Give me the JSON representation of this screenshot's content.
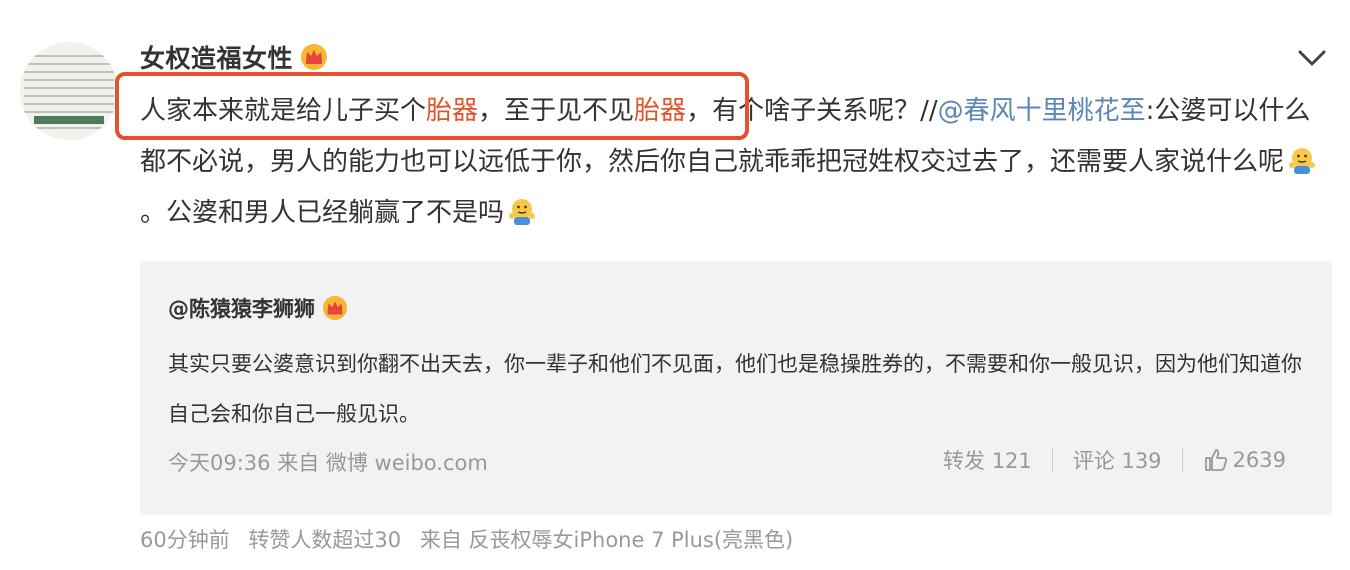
{
  "post": {
    "username": "女权造福女性",
    "text_p1": "人家本来就是给儿子买个",
    "highlight_1": "胎器",
    "text_p2": "，至于见不见",
    "highlight_2": "胎器",
    "text_p3": "，有个啥子关系呢？//",
    "mention": "@春风十里桃花至",
    "text_p4": ":公婆可以什么都不必说，男人的能力也可以远低于你，然后你自己就乖乖把冠姓权交过去了，还需要人家说什么呢",
    "text_p5": "。公婆和男人已经躺赢了不是吗"
  },
  "repost": {
    "username": "@陈猿猿李狮狮",
    "text": "其实只要公婆意识到你翻不出天去，你一辈子和他们不见面，他们也是稳操胜券的，不需要和你一般见识，因为他们知道你自己会和你自己一般见识。",
    "meta": "今天09:36 来自 微博 weibo.com",
    "repost_label": "转发 121",
    "comment_label": "评论 139",
    "like_count": "2639"
  },
  "footer": {
    "time": "60分钟前",
    "likes_note": "转赞人数超过30",
    "source": "来自 反丧权辱女iPhone 7 Plus(亮黑色)"
  },
  "colors": {
    "highlight": "#e2532e",
    "link": "#5a86b8",
    "muted": "#999999",
    "repost_bg": "#f2f2f5"
  },
  "icons": {
    "crown": "crown-icon",
    "emoji": "shrug-emoji-icon",
    "expand": "chevron-down-icon",
    "like": "thumbs-up-icon"
  }
}
